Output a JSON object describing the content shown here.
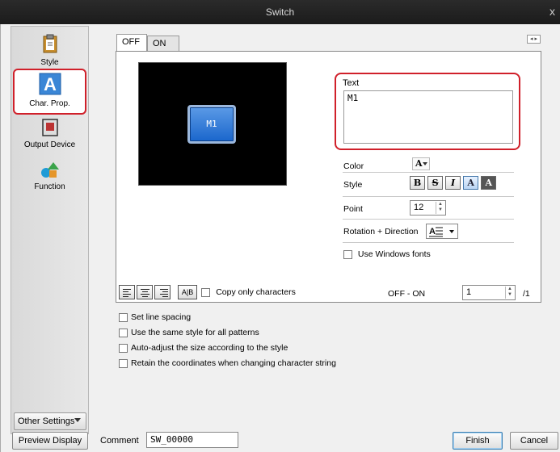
{
  "window": {
    "title": "Switch",
    "close_glyph": "x"
  },
  "sidebar": {
    "items": [
      {
        "label": "Style",
        "icon": "clipboard-icon"
      },
      {
        "label": "Char. Prop.",
        "icon": "font-a-icon",
        "selected": true
      },
      {
        "label": "Output Device",
        "icon": "switch-device-icon"
      },
      {
        "label": "Function",
        "icon": "shapes-icon"
      }
    ],
    "other_settings": "Other Settings"
  },
  "tabs": [
    {
      "label": "OFF",
      "active": true
    },
    {
      "label": "ON",
      "active": false
    }
  ],
  "preview": {
    "button_text": "M1"
  },
  "text": {
    "label": "Text",
    "value": "M1"
  },
  "props": {
    "color_label": "Color",
    "color_glyph": "A",
    "style_label": "Style",
    "style_buttons": [
      "B",
      "S",
      "I",
      "A",
      "A"
    ],
    "point_label": "Point",
    "point_value": "12",
    "rotation_label": "Rotation + Direction",
    "use_windows_fonts": "Use Windows fonts"
  },
  "alignment": {
    "copy_only": "Copy only characters",
    "range_label": "OFF - ON",
    "index_value": "1",
    "index_total": "/1"
  },
  "options": [
    "Set line spacing",
    "Use the same style for all patterns",
    "Auto-adjust the size according to the style",
    "Retain the coordinates when changing character string"
  ],
  "bottom": {
    "preview_display": "Preview Display",
    "comment_label": "Comment",
    "comment_value": "SW_00000",
    "finish": "Finish",
    "cancel": "Cancel"
  },
  "colors": {
    "selection_outline": "#d0202a",
    "preview_button": "#1a66cc"
  }
}
